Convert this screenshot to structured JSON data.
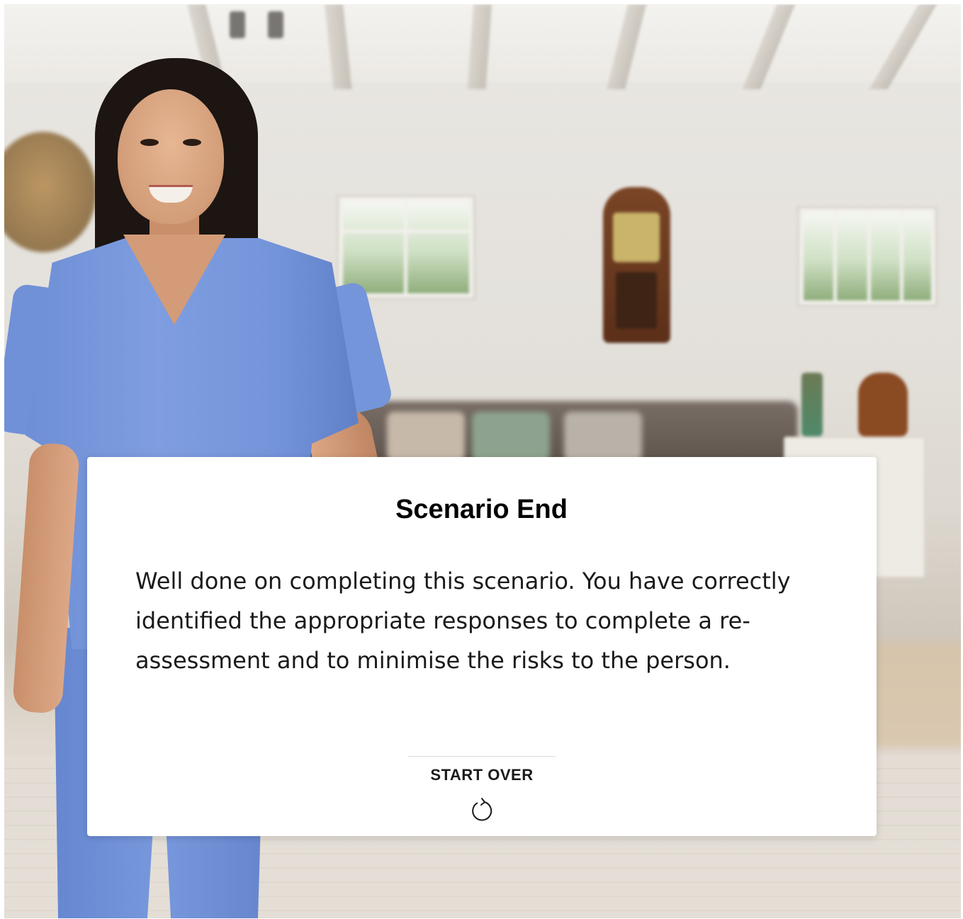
{
  "dialog": {
    "title": "Scenario End",
    "message": "Well done on completing this scenario. You have correctly identified the appropriate responses to complete a re-assessment and to minimise the risks to the person.",
    "start_over_label": "START OVER",
    "start_over_icon": "restart-icon"
  },
  "scene": {
    "background": "room-interior-photo",
    "character": "nurse-in-blue-scrubs",
    "scrub_color": "#7494da"
  }
}
